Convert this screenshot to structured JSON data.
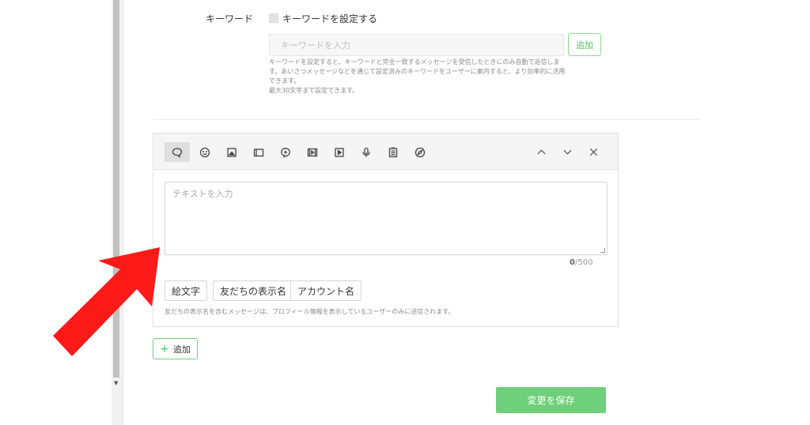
{
  "keyword": {
    "label": "キーワード",
    "checkbox_label": "キーワードを設定する",
    "input_placeholder": "キーワードを入力",
    "add_label": "追加",
    "help_lines": [
      "キーワードを設定すると、キーワードと完全一致するメッセージを受信したときにのみ自動で返信しま",
      "す。あいさつメッセージなどを通じて設定済みのキーワードをユーザーに案内すると、より効率的に活用",
      "できます。",
      "最大30文字まで設定できます。"
    ]
  },
  "editor": {
    "toolbar_icons": [
      "speech-bubble-icon",
      "emoji-icon",
      "image-icon",
      "card-icon",
      "coupon-icon",
      "video-icon",
      "play-icon",
      "microphone-icon",
      "survey-icon",
      "compass-icon"
    ],
    "controls": [
      "chevron-up-icon",
      "chevron-down-icon",
      "close-icon"
    ],
    "text_placeholder": "テキストを入力",
    "counter_current": "0",
    "counter_max": "/500",
    "chips": [
      "絵文字",
      "友だちの表示名",
      "アカウント名"
    ],
    "note": "友だちの表示名を含むメッセージは、プロフィール情報を表示しているユーザーのみに送信されます。"
  },
  "add_button": {
    "icon": "+",
    "label": "追加"
  },
  "save_button": {
    "label": "変更を保存"
  },
  "colors": {
    "accent_green": "#4cc764",
    "save_green": "#6fcf7a",
    "annotation_red": "#ff1a1a"
  }
}
